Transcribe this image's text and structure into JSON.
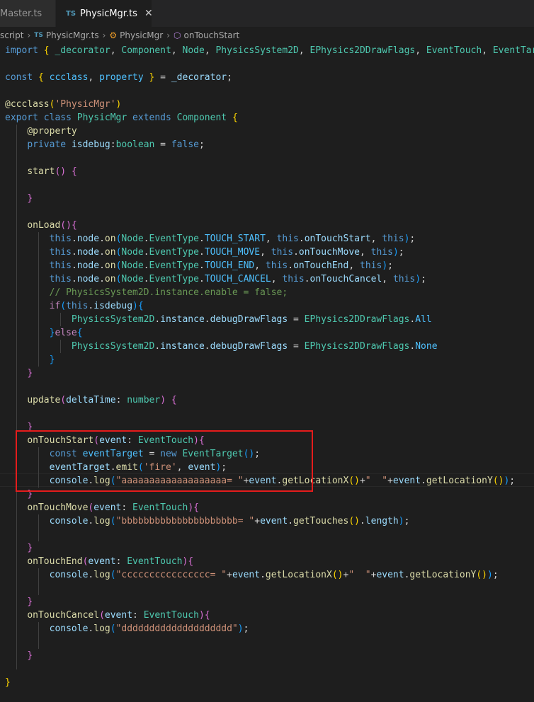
{
  "tabs": [
    {
      "label": "Master.ts"
    },
    {
      "label": "PhysicMgr.ts",
      "badge": "TS",
      "close": "✕"
    }
  ],
  "breadcrumb": {
    "folder": "script",
    "file_badge": "TS",
    "file": "PhysicMgr.ts",
    "class_name": "PhysicMgr",
    "method": "onTouchStart"
  },
  "editor": {
    "lines": [
      [
        [
          "kw",
          "import "
        ],
        [
          "br1",
          "{ "
        ],
        [
          "cls",
          "_decorator"
        ],
        [
          "pn",
          ", "
        ],
        [
          "cls",
          "Component"
        ],
        [
          "pn",
          ", "
        ],
        [
          "cls",
          "Node"
        ],
        [
          "pn",
          ", "
        ],
        [
          "cls",
          "PhysicsSystem2D"
        ],
        [
          "pn",
          ", "
        ],
        [
          "cls",
          "EPhysics2DDrawFlags"
        ],
        [
          "pn",
          ", "
        ],
        [
          "cls",
          "EventTouch"
        ],
        [
          "pn",
          ", "
        ],
        [
          "cls",
          "EventTarg"
        ]
      ],
      [],
      [
        [
          "kw",
          "const "
        ],
        [
          "br1",
          "{ "
        ],
        [
          "con",
          "ccclass"
        ],
        [
          "pn",
          ", "
        ],
        [
          "con",
          "property "
        ],
        [
          "br1",
          "}"
        ],
        [
          "pn",
          " = "
        ],
        [
          "var",
          "_decorator"
        ],
        [
          "pn",
          ";"
        ]
      ],
      [],
      [
        [
          "fn",
          "@ccclass"
        ],
        [
          "br1",
          "("
        ],
        [
          "str",
          "'PhysicMgr'"
        ],
        [
          "br1",
          ")"
        ]
      ],
      [
        [
          "kw",
          "export "
        ],
        [
          "kw",
          "class "
        ],
        [
          "cls",
          "PhysicMgr "
        ],
        [
          "kw",
          "extends "
        ],
        [
          "cls",
          "Component "
        ],
        [
          "br1",
          "{"
        ]
      ],
      [
        [
          "pn",
          "    "
        ],
        [
          "fn",
          "@property"
        ]
      ],
      [
        [
          "pn",
          "    "
        ],
        [
          "kw",
          "private "
        ],
        [
          "var",
          "isdebug"
        ],
        [
          "pn",
          ":"
        ],
        [
          "cls",
          "boolean"
        ],
        [
          "pn",
          " = "
        ],
        [
          "kw",
          "false"
        ],
        [
          "pn",
          ";"
        ]
      ],
      [],
      [
        [
          "pn",
          "    "
        ],
        [
          "fn",
          "start"
        ],
        [
          "br2",
          "()"
        ],
        [
          "pn",
          " "
        ],
        [
          "br2",
          "{"
        ]
      ],
      [],
      [
        [
          "pn",
          "    "
        ],
        [
          "br2",
          "}"
        ]
      ],
      [],
      [
        [
          "pn",
          "    "
        ],
        [
          "fn",
          "onLoad"
        ],
        [
          "br2",
          "()"
        ],
        [
          "br2",
          "{"
        ]
      ],
      [
        [
          "pn",
          "        "
        ],
        [
          "kw",
          "this"
        ],
        [
          "pn",
          "."
        ],
        [
          "var",
          "node"
        ],
        [
          "pn",
          "."
        ],
        [
          "fn",
          "on"
        ],
        [
          "br3",
          "("
        ],
        [
          "cls",
          "Node"
        ],
        [
          "pn",
          "."
        ],
        [
          "cls",
          "EventType"
        ],
        [
          "pn",
          "."
        ],
        [
          "con",
          "TOUCH_START"
        ],
        [
          "pn",
          ", "
        ],
        [
          "kw",
          "this"
        ],
        [
          "pn",
          "."
        ],
        [
          "var",
          "onTouchStart"
        ],
        [
          "pn",
          ", "
        ],
        [
          "kw",
          "this"
        ],
        [
          "br3",
          ")"
        ],
        [
          "pn",
          ";"
        ]
      ],
      [
        [
          "pn",
          "        "
        ],
        [
          "kw",
          "this"
        ],
        [
          "pn",
          "."
        ],
        [
          "var",
          "node"
        ],
        [
          "pn",
          "."
        ],
        [
          "fn",
          "on"
        ],
        [
          "br3",
          "("
        ],
        [
          "cls",
          "Node"
        ],
        [
          "pn",
          "."
        ],
        [
          "cls",
          "EventType"
        ],
        [
          "pn",
          "."
        ],
        [
          "con",
          "TOUCH_MOVE"
        ],
        [
          "pn",
          ", "
        ],
        [
          "kw",
          "this"
        ],
        [
          "pn",
          "."
        ],
        [
          "var",
          "onTouchMove"
        ],
        [
          "pn",
          ", "
        ],
        [
          "kw",
          "this"
        ],
        [
          "br3",
          ")"
        ],
        [
          "pn",
          ";"
        ]
      ],
      [
        [
          "pn",
          "        "
        ],
        [
          "kw",
          "this"
        ],
        [
          "pn",
          "."
        ],
        [
          "var",
          "node"
        ],
        [
          "pn",
          "."
        ],
        [
          "fn",
          "on"
        ],
        [
          "br3",
          "("
        ],
        [
          "cls",
          "Node"
        ],
        [
          "pn",
          "."
        ],
        [
          "cls",
          "EventType"
        ],
        [
          "pn",
          "."
        ],
        [
          "con",
          "TOUCH_END"
        ],
        [
          "pn",
          ", "
        ],
        [
          "kw",
          "this"
        ],
        [
          "pn",
          "."
        ],
        [
          "var",
          "onTouchEnd"
        ],
        [
          "pn",
          ", "
        ],
        [
          "kw",
          "this"
        ],
        [
          "br3",
          ")"
        ],
        [
          "pn",
          ";"
        ]
      ],
      [
        [
          "pn",
          "        "
        ],
        [
          "kw",
          "this"
        ],
        [
          "pn",
          "."
        ],
        [
          "var",
          "node"
        ],
        [
          "pn",
          "."
        ],
        [
          "fn",
          "on"
        ],
        [
          "br3",
          "("
        ],
        [
          "cls",
          "Node"
        ],
        [
          "pn",
          "."
        ],
        [
          "cls",
          "EventType"
        ],
        [
          "pn",
          "."
        ],
        [
          "con",
          "TOUCH_CANCEL"
        ],
        [
          "pn",
          ", "
        ],
        [
          "kw",
          "this"
        ],
        [
          "pn",
          "."
        ],
        [
          "var",
          "onTouchCancel"
        ],
        [
          "pn",
          ", "
        ],
        [
          "kw",
          "this"
        ],
        [
          "br3",
          ")"
        ],
        [
          "pn",
          ";"
        ]
      ],
      [
        [
          "pn",
          "        "
        ],
        [
          "cmt",
          "// PhysicsSystem2D.instance.enable = false;"
        ]
      ],
      [
        [
          "pn",
          "        "
        ],
        [
          "ctl",
          "if"
        ],
        [
          "br3",
          "("
        ],
        [
          "kw",
          "this"
        ],
        [
          "pn",
          "."
        ],
        [
          "var",
          "isdebug"
        ],
        [
          "br3",
          ")"
        ],
        [
          "br3",
          "{"
        ]
      ],
      [
        [
          "pn",
          "            "
        ],
        [
          "cls",
          "PhysicsSystem2D"
        ],
        [
          "pn",
          "."
        ],
        [
          "var",
          "instance"
        ],
        [
          "pn",
          "."
        ],
        [
          "var",
          "debugDrawFlags"
        ],
        [
          "pn",
          " = "
        ],
        [
          "cls",
          "EPhysics2DDrawFlags"
        ],
        [
          "pn",
          "."
        ],
        [
          "con",
          "All"
        ]
      ],
      [
        [
          "pn",
          "        "
        ],
        [
          "br3",
          "}"
        ],
        [
          "ctl",
          "else"
        ],
        [
          "br3",
          "{"
        ]
      ],
      [
        [
          "pn",
          "            "
        ],
        [
          "cls",
          "PhysicsSystem2D"
        ],
        [
          "pn",
          "."
        ],
        [
          "var",
          "instance"
        ],
        [
          "pn",
          "."
        ],
        [
          "var",
          "debugDrawFlags"
        ],
        [
          "pn",
          " = "
        ],
        [
          "cls",
          "EPhysics2DDrawFlags"
        ],
        [
          "pn",
          "."
        ],
        [
          "con",
          "None"
        ]
      ],
      [
        [
          "pn",
          "        "
        ],
        [
          "br3",
          "}"
        ]
      ],
      [
        [
          "pn",
          "    "
        ],
        [
          "br2",
          "}"
        ]
      ],
      [],
      [
        [
          "pn",
          "    "
        ],
        [
          "fn",
          "update"
        ],
        [
          "br2",
          "("
        ],
        [
          "var",
          "deltaTime"
        ],
        [
          "pn",
          ": "
        ],
        [
          "cls",
          "number"
        ],
        [
          "br2",
          ")"
        ],
        [
          "pn",
          " "
        ],
        [
          "br2",
          "{"
        ]
      ],
      [],
      [
        [
          "pn",
          "    "
        ],
        [
          "br2",
          "}"
        ]
      ],
      [
        [
          "pn",
          "    "
        ],
        [
          "fn",
          "onTouchStart"
        ],
        [
          "br2",
          "("
        ],
        [
          "var",
          "event"
        ],
        [
          "pn",
          ": "
        ],
        [
          "cls",
          "EventTouch"
        ],
        [
          "br2",
          ")"
        ],
        [
          "br2",
          "{"
        ]
      ],
      [
        [
          "pn",
          "        "
        ],
        [
          "kw",
          "const "
        ],
        [
          "con",
          "eventTarget"
        ],
        [
          "pn",
          " = "
        ],
        [
          "kw",
          "new "
        ],
        [
          "cls",
          "EventTarget"
        ],
        [
          "br3",
          "()"
        ],
        [
          "pn",
          ";"
        ]
      ],
      [
        [
          "pn",
          "        "
        ],
        [
          "var",
          "eventTarget"
        ],
        [
          "pn",
          "."
        ],
        [
          "fn",
          "emit"
        ],
        [
          "br3",
          "("
        ],
        [
          "str",
          "'fire'"
        ],
        [
          "pn",
          ", "
        ],
        [
          "var",
          "event"
        ],
        [
          "br3",
          ")"
        ],
        [
          "pn",
          ";"
        ]
      ],
      [
        [
          "pn",
          "        "
        ],
        [
          "var",
          "console"
        ],
        [
          "pn",
          "."
        ],
        [
          "fn",
          "log"
        ],
        [
          "br3",
          "("
        ],
        [
          "str",
          "\"aaaaaaaaaaaaaaaaaaa= \""
        ],
        [
          "pn",
          "+"
        ],
        [
          "var",
          "event"
        ],
        [
          "pn",
          "."
        ],
        [
          "fn",
          "getLocationX"
        ],
        [
          "br1",
          "()"
        ],
        [
          "pn",
          "+"
        ],
        [
          "str",
          "\"  \""
        ],
        [
          "pn",
          "+"
        ],
        [
          "var",
          "event"
        ],
        [
          "pn",
          "."
        ],
        [
          "fn",
          "getLocationY"
        ],
        [
          "br1",
          "()"
        ],
        [
          "br3",
          ")"
        ],
        [
          "pn",
          ";"
        ]
      ],
      [
        [
          "pn",
          "    "
        ],
        [
          "br2",
          "}"
        ]
      ],
      [
        [
          "pn",
          "    "
        ],
        [
          "fn",
          "onTouchMove"
        ],
        [
          "br2",
          "("
        ],
        [
          "var",
          "event"
        ],
        [
          "pn",
          ": "
        ],
        [
          "cls",
          "EventTouch"
        ],
        [
          "br2",
          ")"
        ],
        [
          "br2",
          "{"
        ]
      ],
      [
        [
          "pn",
          "        "
        ],
        [
          "var",
          "console"
        ],
        [
          "pn",
          "."
        ],
        [
          "fn",
          "log"
        ],
        [
          "br3",
          "("
        ],
        [
          "str",
          "\"bbbbbbbbbbbbbbbbbbbbb= \""
        ],
        [
          "pn",
          "+"
        ],
        [
          "var",
          "event"
        ],
        [
          "pn",
          "."
        ],
        [
          "fn",
          "getTouches"
        ],
        [
          "br1",
          "()"
        ],
        [
          "pn",
          "."
        ],
        [
          "var",
          "length"
        ],
        [
          "br3",
          ")"
        ],
        [
          "pn",
          ";"
        ]
      ],
      [],
      [
        [
          "pn",
          "    "
        ],
        [
          "br2",
          "}"
        ]
      ],
      [
        [
          "pn",
          "    "
        ],
        [
          "fn",
          "onTouchEnd"
        ],
        [
          "br2",
          "("
        ],
        [
          "var",
          "event"
        ],
        [
          "pn",
          ": "
        ],
        [
          "cls",
          "EventTouch"
        ],
        [
          "br2",
          ")"
        ],
        [
          "br2",
          "{"
        ]
      ],
      [
        [
          "pn",
          "        "
        ],
        [
          "var",
          "console"
        ],
        [
          "pn",
          "."
        ],
        [
          "fn",
          "log"
        ],
        [
          "br3",
          "("
        ],
        [
          "str",
          "\"cccccccccccccccc= \""
        ],
        [
          "pn",
          "+"
        ],
        [
          "var",
          "event"
        ],
        [
          "pn",
          "."
        ],
        [
          "fn",
          "getLocationX"
        ],
        [
          "br1",
          "()"
        ],
        [
          "pn",
          "+"
        ],
        [
          "str",
          "\"  \""
        ],
        [
          "pn",
          "+"
        ],
        [
          "var",
          "event"
        ],
        [
          "pn",
          "."
        ],
        [
          "fn",
          "getLocationY"
        ],
        [
          "br1",
          "()"
        ],
        [
          "br3",
          ")"
        ],
        [
          "pn",
          ";"
        ]
      ],
      [],
      [
        [
          "pn",
          "    "
        ],
        [
          "br2",
          "}"
        ]
      ],
      [
        [
          "pn",
          "    "
        ],
        [
          "fn",
          "onTouchCancel"
        ],
        [
          "br2",
          "("
        ],
        [
          "var",
          "event"
        ],
        [
          "pn",
          ": "
        ],
        [
          "cls",
          "EventTouch"
        ],
        [
          "br2",
          ")"
        ],
        [
          "br2",
          "{"
        ]
      ],
      [
        [
          "pn",
          "        "
        ],
        [
          "var",
          "console"
        ],
        [
          "pn",
          "."
        ],
        [
          "fn",
          "log"
        ],
        [
          "br3",
          "("
        ],
        [
          "str",
          "\"dddddddddddddddddddd\""
        ],
        [
          "br3",
          ")"
        ],
        [
          "pn",
          ";"
        ]
      ],
      [],
      [
        [
          "pn",
          "    "
        ],
        [
          "br2",
          "}"
        ]
      ],
      [],
      [
        [
          "br1",
          "}"
        ]
      ]
    ]
  }
}
